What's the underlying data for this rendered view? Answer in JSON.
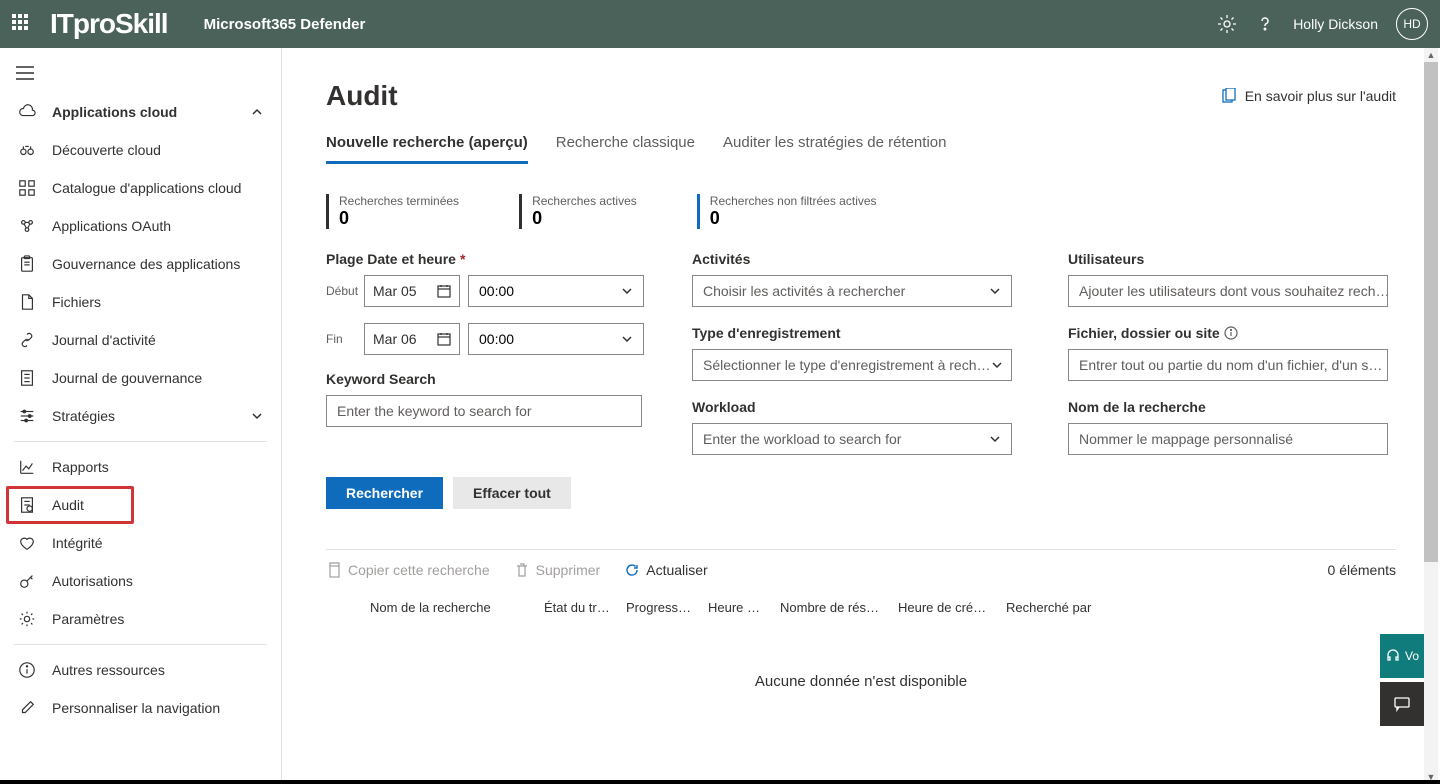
{
  "header": {
    "brand": "ITproSkill",
    "product": "Microsoft365 Defender",
    "username": "Holly Dickson",
    "avatar_initials": "HD"
  },
  "sidebar": {
    "applications_cloud": "Applications cloud",
    "decouverte": "Découverte cloud",
    "catalogue": "Catalogue d'applications cloud",
    "oauth": "Applications OAuth",
    "gouvernance": "Gouvernance des applications",
    "fichiers": "Fichiers",
    "journal_activite": "Journal d'activité",
    "journal_gouvernance": "Journal de gouvernance",
    "strategies": "Stratégies",
    "rapports": "Rapports",
    "audit": "Audit",
    "integrite": "Intégrité",
    "autorisations": "Autorisations",
    "parametres": "Paramètres",
    "autres": "Autres ressources",
    "personnaliser": "Personnaliser la navigation"
  },
  "page": {
    "title": "Audit",
    "learn_more": "En savoir plus sur l'audit",
    "tabs": {
      "nouvelle": "Nouvelle recherche (aperçu)",
      "classique": "Recherche classique",
      "retention": "Auditer les stratégies de rétention"
    },
    "stats": {
      "completed_label": "Recherches terminées",
      "completed_value": "0",
      "active_label": "Recherches actives",
      "active_value": "0",
      "unfiltered_label": "Recherches non filtrées actives",
      "unfiltered_value": "0"
    },
    "form": {
      "date_range_label": "Plage Date et heure",
      "start_label": "Début",
      "start_date": "Mar 05",
      "start_time": "00:00",
      "end_label": "Fin",
      "end_date": "Mar 06",
      "end_time": "00:00",
      "keyword_label": "Keyword Search",
      "keyword_placeholder": "Enter the keyword to search for",
      "activities_label": "Activités",
      "activities_placeholder": "Choisir les activités à rechercher",
      "record_type_label": "Type d'enregistrement",
      "record_type_placeholder": "Sélectionner le type d'enregistrement à rech…",
      "workload_label": "Workload",
      "workload_placeholder": "Enter the workload to search for",
      "users_label": "Utilisateurs",
      "users_placeholder": "Ajouter les utilisateurs dont vous souhaitez rech…",
      "file_label": "Fichier, dossier ou site",
      "file_placeholder": "Entrer tout ou partie du nom d'un fichier, d'un s…",
      "search_name_label": "Nom de la recherche",
      "search_name_placeholder": "Nommer le mappage personnalisé",
      "search_btn": "Rechercher",
      "clear_btn": "Effacer tout"
    },
    "toolbar": {
      "copy": "Copier cette recherche",
      "delete": "Supprimer",
      "refresh": "Actualiser",
      "items": "0 éléments"
    },
    "table": {
      "col_name": "Nom de la recherche",
      "col_status": "État du travail",
      "col_progress": "Progressi…",
      "col_time": "Heure de…",
      "col_results": "Nombre de résultats",
      "col_created": "Heure de créati…",
      "col_searched_by": "Recherché par",
      "no_data": "Aucune donnée n'est disponible"
    },
    "float_label": "Vo"
  }
}
